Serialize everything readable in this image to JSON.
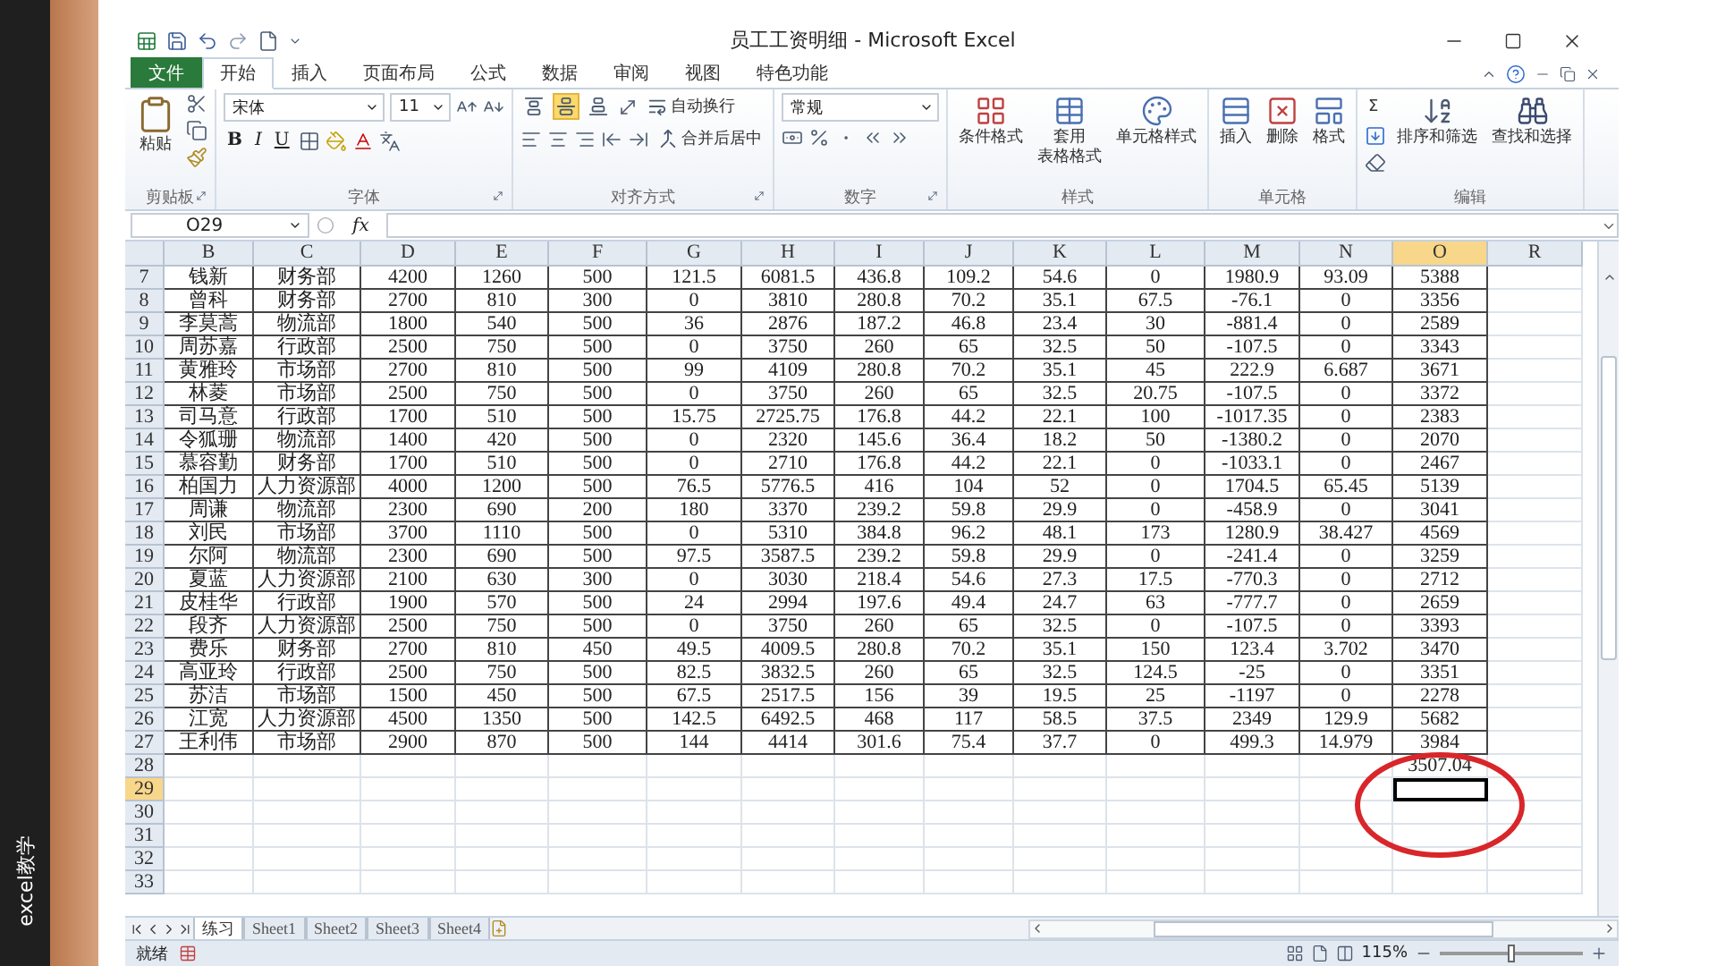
{
  "side_strip": {
    "label": "excel教学"
  },
  "window": {
    "title": "员工工资明细 - Microsoft Excel"
  },
  "tabs": [
    {
      "label": "文件",
      "kind": "file",
      "selected": false
    },
    {
      "label": "开始",
      "kind": "tab",
      "selected": true
    },
    {
      "label": "插入",
      "kind": "tab",
      "selected": false
    },
    {
      "label": "页面布局",
      "kind": "tab",
      "selected": false
    },
    {
      "label": "公式",
      "kind": "tab",
      "selected": false
    },
    {
      "label": "数据",
      "kind": "tab",
      "selected": false
    },
    {
      "label": "审阅",
      "kind": "tab",
      "selected": false
    },
    {
      "label": "视图",
      "kind": "tab",
      "selected": false
    },
    {
      "label": "特色功能",
      "kind": "tab",
      "selected": false
    }
  ],
  "ribbon": {
    "clipboard": {
      "label": "剪贴板",
      "paste": "粘贴"
    },
    "font": {
      "label": "字体",
      "name": "宋体",
      "size": "11",
      "bold": "B",
      "italic": "I",
      "underline": "U"
    },
    "alignment": {
      "label": "对齐方式",
      "wrap": "自动换行",
      "merge": "合并后居中",
      "vertical": [
        {
          "selected": false
        },
        {
          "selected": true
        },
        {
          "selected": false
        }
      ]
    },
    "number": {
      "label": "数字",
      "format": "常规"
    },
    "styles": {
      "label": "样式",
      "conditional": "条件格式",
      "table_lines": [
        "套用",
        "表格格式"
      ],
      "cell_styles": "单元格样式"
    },
    "cells": {
      "label": "单元格",
      "insert": "插入",
      "delete": "删除",
      "format": "格式"
    },
    "editing": {
      "label": "编辑",
      "sum": "Σ",
      "sort": "排序和筛选",
      "find": "查找和选择"
    }
  },
  "formula_bar": {
    "name_box": "O29",
    "fx": "fx"
  },
  "sheet": {
    "columns": [
      {
        "label": "B",
        "selected": false
      },
      {
        "label": "C",
        "selected": false
      },
      {
        "label": "D",
        "selected": false
      },
      {
        "label": "E",
        "selected": false
      },
      {
        "label": "F",
        "selected": false
      },
      {
        "label": "G",
        "selected": false
      },
      {
        "label": "H",
        "selected": false
      },
      {
        "label": "I",
        "selected": false
      },
      {
        "label": "J",
        "selected": false
      },
      {
        "label": "K",
        "selected": false
      },
      {
        "label": "L",
        "selected": false
      },
      {
        "label": "M",
        "selected": false
      },
      {
        "label": "N",
        "selected": false
      },
      {
        "label": "O",
        "selected": true
      },
      {
        "label": "R",
        "selected": false
      }
    ],
    "rows": [
      {
        "n": "7",
        "selected": false,
        "cells": [
          "钱新",
          "财务部",
          "4200",
          "1260",
          "500",
          "121.5",
          "6081.5",
          "436.8",
          "109.2",
          "54.6",
          "0",
          "1980.9",
          "93.09",
          "5388"
        ]
      },
      {
        "n": "8",
        "selected": false,
        "cells": [
          "曾科",
          "财务部",
          "2700",
          "810",
          "300",
          "0",
          "3810",
          "280.8",
          "70.2",
          "35.1",
          "67.5",
          "-76.1",
          "0",
          "3356"
        ]
      },
      {
        "n": "9",
        "selected": false,
        "cells": [
          "李莫蒿",
          "物流部",
          "1800",
          "540",
          "500",
          "36",
          "2876",
          "187.2",
          "46.8",
          "23.4",
          "30",
          "-881.4",
          "0",
          "2589"
        ]
      },
      {
        "n": "10",
        "selected": false,
        "cells": [
          "周苏嘉",
          "行政部",
          "2500",
          "750",
          "500",
          "0",
          "3750",
          "260",
          "65",
          "32.5",
          "50",
          "-107.5",
          "0",
          "3343"
        ]
      },
      {
        "n": "11",
        "selected": false,
        "cells": [
          "黄雅玲",
          "市场部",
          "2700",
          "810",
          "500",
          "99",
          "4109",
          "280.8",
          "70.2",
          "35.1",
          "45",
          "222.9",
          "6.687",
          "3671"
        ]
      },
      {
        "n": "12",
        "selected": false,
        "cells": [
          "林菱",
          "市场部",
          "2500",
          "750",
          "500",
          "0",
          "3750",
          "260",
          "65",
          "32.5",
          "20.75",
          "-107.5",
          "0",
          "3372"
        ]
      },
      {
        "n": "13",
        "selected": false,
        "cells": [
          "司马意",
          "行政部",
          "1700",
          "510",
          "500",
          "15.75",
          "2725.75",
          "176.8",
          "44.2",
          "22.1",
          "100",
          "-1017.35",
          "0",
          "2383"
        ]
      },
      {
        "n": "14",
        "selected": false,
        "cells": [
          "令狐珊",
          "物流部",
          "1400",
          "420",
          "500",
          "0",
          "2320",
          "145.6",
          "36.4",
          "18.2",
          "50",
          "-1380.2",
          "0",
          "2070"
        ]
      },
      {
        "n": "15",
        "selected": false,
        "cells": [
          "慕容勤",
          "财务部",
          "1700",
          "510",
          "500",
          "0",
          "2710",
          "176.8",
          "44.2",
          "22.1",
          "0",
          "-1033.1",
          "0",
          "2467"
        ]
      },
      {
        "n": "16",
        "selected": false,
        "cells": [
          "柏国力",
          "人力资源部",
          "4000",
          "1200",
          "500",
          "76.5",
          "5776.5",
          "416",
          "104",
          "52",
          "0",
          "1704.5",
          "65.45",
          "5139"
        ]
      },
      {
        "n": "17",
        "selected": false,
        "cells": [
          "周谦",
          "物流部",
          "2300",
          "690",
          "200",
          "180",
          "3370",
          "239.2",
          "59.8",
          "29.9",
          "0",
          "-458.9",
          "0",
          "3041"
        ]
      },
      {
        "n": "18",
        "selected": false,
        "cells": [
          "刘民",
          "市场部",
          "3700",
          "1110",
          "500",
          "0",
          "5310",
          "384.8",
          "96.2",
          "48.1",
          "173",
          "1280.9",
          "38.427",
          "4569"
        ]
      },
      {
        "n": "19",
        "selected": false,
        "cells": [
          "尔阿",
          "物流部",
          "2300",
          "690",
          "500",
          "97.5",
          "3587.5",
          "239.2",
          "59.8",
          "29.9",
          "0",
          "-241.4",
          "0",
          "3259"
        ]
      },
      {
        "n": "20",
        "selected": false,
        "cells": [
          "夏蓝",
          "人力资源部",
          "2100",
          "630",
          "300",
          "0",
          "3030",
          "218.4",
          "54.6",
          "27.3",
          "17.5",
          "-770.3",
          "0",
          "2712"
        ]
      },
      {
        "n": "21",
        "selected": false,
        "cells": [
          "皮桂华",
          "行政部",
          "1900",
          "570",
          "500",
          "24",
          "2994",
          "197.6",
          "49.4",
          "24.7",
          "63",
          "-777.7",
          "0",
          "2659"
        ]
      },
      {
        "n": "22",
        "selected": false,
        "cells": [
          "段齐",
          "人力资源部",
          "2500",
          "750",
          "500",
          "0",
          "3750",
          "260",
          "65",
          "32.5",
          "0",
          "-107.5",
          "0",
          "3393"
        ]
      },
      {
        "n": "23",
        "selected": false,
        "cells": [
          "费乐",
          "财务部",
          "2700",
          "810",
          "450",
          "49.5",
          "4009.5",
          "280.8",
          "70.2",
          "35.1",
          "150",
          "123.4",
          "3.702",
          "3470"
        ]
      },
      {
        "n": "24",
        "selected": false,
        "cells": [
          "高亚玲",
          "行政部",
          "2500",
          "750",
          "500",
          "82.5",
          "3832.5",
          "260",
          "65",
          "32.5",
          "124.5",
          "-25",
          "0",
          "3351"
        ]
      },
      {
        "n": "25",
        "selected": false,
        "cells": [
          "苏洁",
          "市场部",
          "1500",
          "450",
          "500",
          "67.5",
          "2517.5",
          "156",
          "39",
          "19.5",
          "25",
          "-1197",
          "0",
          "2278"
        ]
      },
      {
        "n": "26",
        "selected": false,
        "cells": [
          "江宽",
          "人力资源部",
          "4500",
          "1350",
          "500",
          "142.5",
          "6492.5",
          "468",
          "117",
          "58.5",
          "37.5",
          "2349",
          "129.9",
          "5682"
        ]
      },
      {
        "n": "27",
        "selected": false,
        "cells": [
          "王利伟",
          "市场部",
          "2900",
          "870",
          "500",
          "144",
          "4414",
          "301.6",
          "75.4",
          "37.7",
          "0",
          "499.3",
          "14.979",
          "3984"
        ]
      },
      {
        "n": "28",
        "selected": false,
        "cells": [
          null,
          null,
          null,
          null,
          null,
          null,
          null,
          null,
          null,
          null,
          null,
          null,
          null,
          "3507.04"
        ]
      },
      {
        "n": "29",
        "selected": true
      },
      {
        "n": "30",
        "selected": false
      },
      {
        "n": "31",
        "selected": false
      },
      {
        "n": "32",
        "selected": false
      },
      {
        "n": "33",
        "selected": false
      }
    ]
  },
  "sheet_tabs": [
    {
      "label": "练习",
      "selected": true
    },
    {
      "label": "Sheet1",
      "selected": false
    },
    {
      "label": "Sheet2",
      "selected": false
    },
    {
      "label": "Sheet3",
      "selected": false
    },
    {
      "label": "Sheet4",
      "selected": false
    }
  ],
  "status_bar": {
    "status": "就绪",
    "zoom": "115%",
    "zoom_slider": {
      "level": 0.5
    }
  }
}
